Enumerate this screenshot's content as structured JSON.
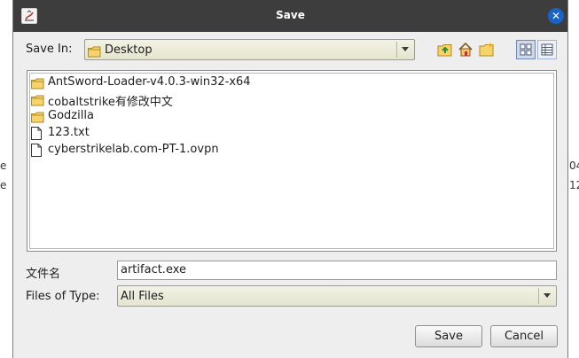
{
  "dialog": {
    "title": "Save",
    "close_icon": "close-icon"
  },
  "save_in": {
    "label": "Save In:",
    "value": "Desktop"
  },
  "toolbar": {
    "up_icon": "up-one-level-icon",
    "home_icon": "home-icon",
    "new_folder_icon": "new-folder-icon",
    "list_view_icon": "list-view-icon",
    "details_view_icon": "details-view-icon"
  },
  "files": [
    {
      "name": "AntSword-Loader-v4.0.3-win32-x64",
      "type": "folder"
    },
    {
      "name": "cobaltstrike有修改中文",
      "type": "folder"
    },
    {
      "name": "Godzilla",
      "type": "folder"
    },
    {
      "name": "123.txt",
      "type": "file"
    },
    {
      "name": "cyberstrikelab.com-PT-1.ovpn",
      "type": "file"
    }
  ],
  "file_name": {
    "label": "文件名",
    "value": "artifact.exe"
  },
  "file_type": {
    "label": "Files of Type:",
    "value": "All Files"
  },
  "buttons": {
    "save": "Save",
    "cancel": "Cancel"
  },
  "colors": {
    "titlebar": "#3d3d3d",
    "close_button": "#1a63c9",
    "dialog_bg": "#eeeeee",
    "combo_bg": "#e9e9d8"
  }
}
